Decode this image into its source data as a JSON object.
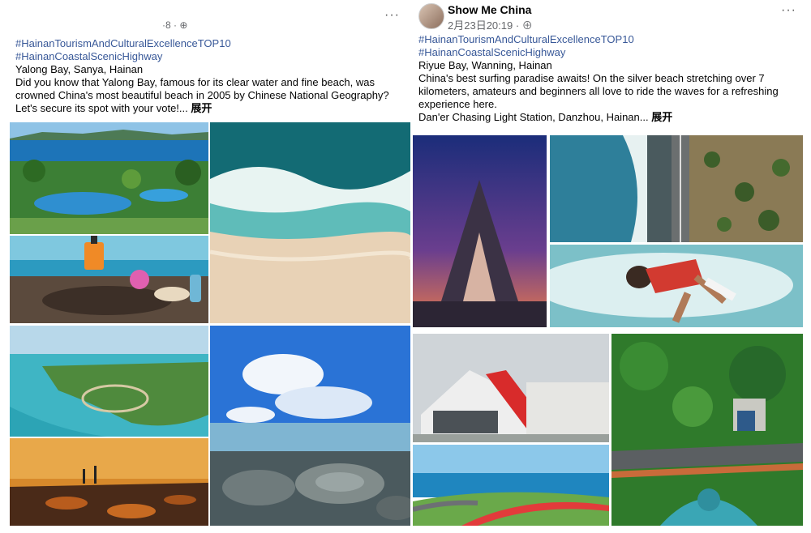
{
  "left_post": {
    "meta_partial": "·8 · ",
    "more_label": "···",
    "hashtags": [
      "#HainanTourismAndCulturalExcellenceTOP10",
      "#HainanCoastalScenicHighway"
    ],
    "location": "Yalong Bay, Sanya, Hainan",
    "body": "Did you know that Yalong Bay, famous for its clear water and fine beach, was crowned China's most beautiful beach in 2005 by Chinese National Geography? Let's secure its spot with your vote!...",
    "expand_label": "展开"
  },
  "right_post": {
    "author": "Show Me China",
    "date": "2月23日20:19 · ",
    "more_label": "···",
    "hashtags": [
      "#HainanTourismAndCulturalExcellenceTOP10",
      "#HainanCoastalScenicHighway"
    ],
    "location": "Riyue Bay, Wanning, Hainan",
    "body": "China's best surfing paradise awaits! On the silver beach stretching over 7 kilometers, amateurs and beginners all love to ride the waves for a refreshing experience here.",
    "extra_line": "Dan'er Chasing Light Station, Danzhou, Hainan...",
    "expand_label": "展开"
  }
}
